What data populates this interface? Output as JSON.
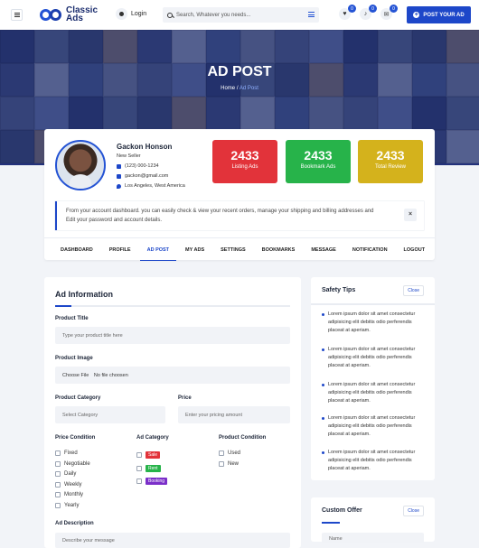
{
  "header": {
    "logo_line1": "Classic",
    "logo_line2": "Ads",
    "login_label": "Login",
    "search_placeholder": "Search, Whatever you needs...",
    "favorites_count": "0",
    "notifications_count": "0",
    "messages_count": "0",
    "post_button_label": "POST YOUR AD"
  },
  "hero": {
    "title": "AD POST",
    "breadcrumb_home": "Home",
    "breadcrumb_sep": "/",
    "breadcrumb_current": "Ad Post"
  },
  "profile": {
    "name": "Gackon Honson",
    "role": "New Seller",
    "phone": "(123) 000-1234",
    "email": "gackon@gmail.com",
    "location": "Los Angeles, West America"
  },
  "stats": [
    {
      "value": "2433",
      "label": "Listing Ads",
      "color": "#e2333a"
    },
    {
      "value": "2433",
      "label": "Bookmark Ads",
      "color": "#27b34a"
    },
    {
      "value": "2433",
      "label": "Total Review",
      "color": "#d4b21c"
    }
  ],
  "notice": {
    "text": "From your account dashboard. you can easily check & view your recent orders, manage your shipping and billing addresses and Edit your password and account details.",
    "close": "×"
  },
  "tabs": [
    "DASHBOARD",
    "PROFILE",
    "AD POST",
    "MY ADS",
    "SETTINGS",
    "BOOKMARKS",
    "MESSAGE",
    "NOTIFICATION",
    "LOGOUT"
  ],
  "form": {
    "title": "Ad Information",
    "product_title_label": "Product Title",
    "product_title_placeholder": "Type your product title here",
    "product_image_label": "Product Image",
    "choose_file": "Choose File",
    "no_file": "No file choosen",
    "category_label": "Product Category",
    "category_placeholder": "Select Category",
    "price_label": "Price",
    "price_placeholder": "Enter your pricing amount",
    "price_condition_label": "Price Condition",
    "price_conditions": [
      "Fixed",
      "Negotiable",
      "Daily",
      "Weekly",
      "Monthly",
      "Yearly"
    ],
    "ad_category_label": "Ad Category",
    "ad_categories": [
      {
        "label": "Sale",
        "color": "#e2333a"
      },
      {
        "label": "Rent",
        "color": "#27b34a"
      },
      {
        "label": "Booking",
        "color": "#7b2fc9"
      }
    ],
    "product_condition_label": "Product Condition",
    "product_conditions": [
      "Used",
      "New"
    ],
    "description_label": "Ad Description",
    "description_placeholder": "Describe your message"
  },
  "safety": {
    "title": "Safety Tips",
    "close_label": "Close",
    "tips": [
      "Lorem ipsum dolor sit amet consectetur adipisicing elit debitis odio perferendis placeat at aperiam.",
      "Lorem ipsum dolor sit amet consectetur adipisicing elit debitis odio perferendis placeat at aperiam.",
      "Lorem ipsum dolor sit amet consectetur adipisicing elit debitis odio perferendis placeat at aperiam.",
      "Lorem ipsum dolor sit amet consectetur adipisicing elit debitis odio perferendis placeat at aperiam.",
      "Lorem ipsum dolor sit amet consectetur adipisicing elit debitis odio perferendis placeat at aperiam."
    ]
  },
  "custom_offer": {
    "title": "Custom Offer",
    "close_label": "Close",
    "name_placeholder": "Name"
  },
  "colors": {
    "accent": "#1d47c9",
    "hero_overlay": "#2d3d8c"
  }
}
